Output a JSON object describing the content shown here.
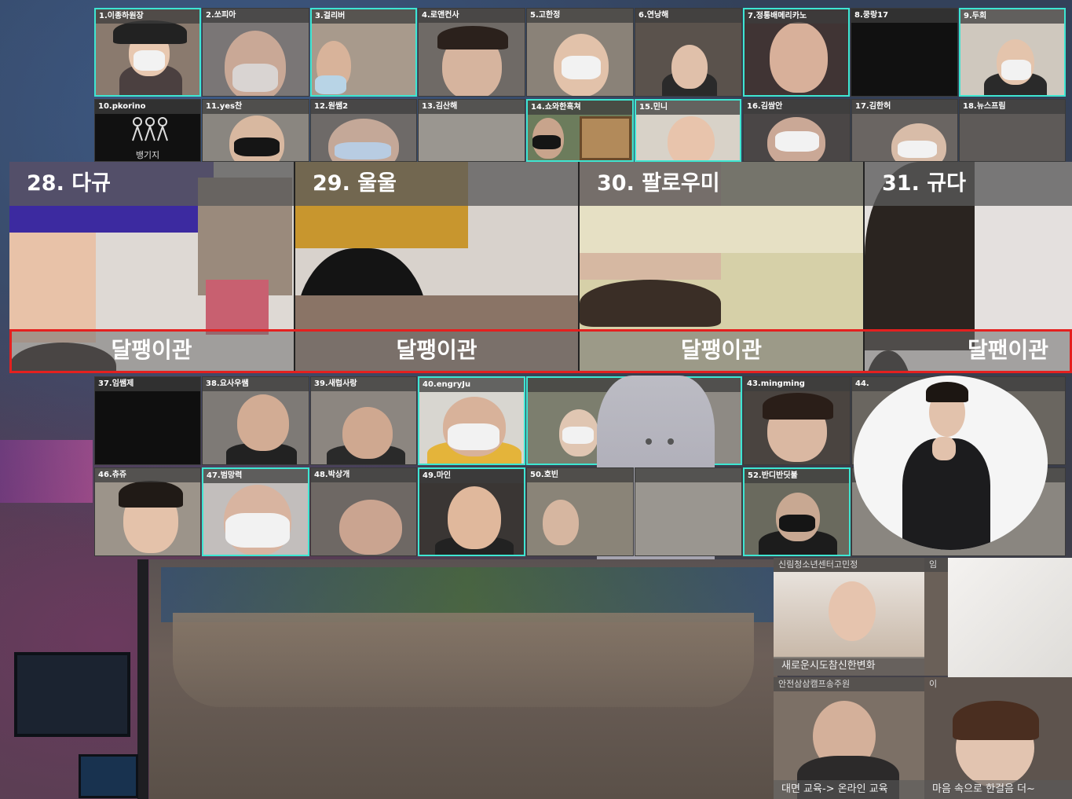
{
  "grid_row1": [
    "1.이종하원장",
    "2.쏘피아",
    "3.걸리버",
    "4.로앤컨사",
    "5.고한정",
    "6.연낭해",
    "7.정통배메리카노",
    "8.쿵랑17",
    "9.두희"
  ],
  "grid_row2": [
    "10.pkorino",
    "11.yes찬",
    "12.원쌤2",
    "13.김산해",
    "14.쇼와한흑쳐",
    "15.민니",
    "16.김쌈안",
    "17.김한허",
    "18.뉴스프림"
  ],
  "tile10_logo_text": "뱅기지",
  "spotlight": [
    {
      "name": "28. 다규",
      "org": "달팽이관"
    },
    {
      "name": "29. 울울",
      "org": "달팽이관"
    },
    {
      "name": "30. 팔로우미",
      "org": "달팽이관"
    },
    {
      "name": "31. 규다",
      "org": "달팬이관"
    }
  ],
  "grid_row3": [
    "37.임쌤제",
    "38.요사우쌤",
    "39.새럽사랑",
    "40.engryJu",
    "",
    "",
    "43.mingming",
    "44."
  ],
  "grid_row4": [
    "46.츄쥬",
    "47.범망력",
    "48.박상개",
    "49.마인",
    "50.호빈",
    "",
    "52.반디반딧불",
    ""
  ],
  "side_panels": {
    "top_left_label": "신림청소년센터고민정",
    "top_right_label": "임",
    "top_left_caption": "새로운시도참신한변화",
    "bottom_left_label": "안전삼삼캠프송주원",
    "bottom_right_label": "이",
    "bottom_left_caption": "대면 교육-> 온라인 교육",
    "bottom_right_caption": "마음 속으로 한걸음 더~"
  },
  "colors": {
    "active_border": "#3ee6d2",
    "highlight_box": "#e4201f"
  }
}
